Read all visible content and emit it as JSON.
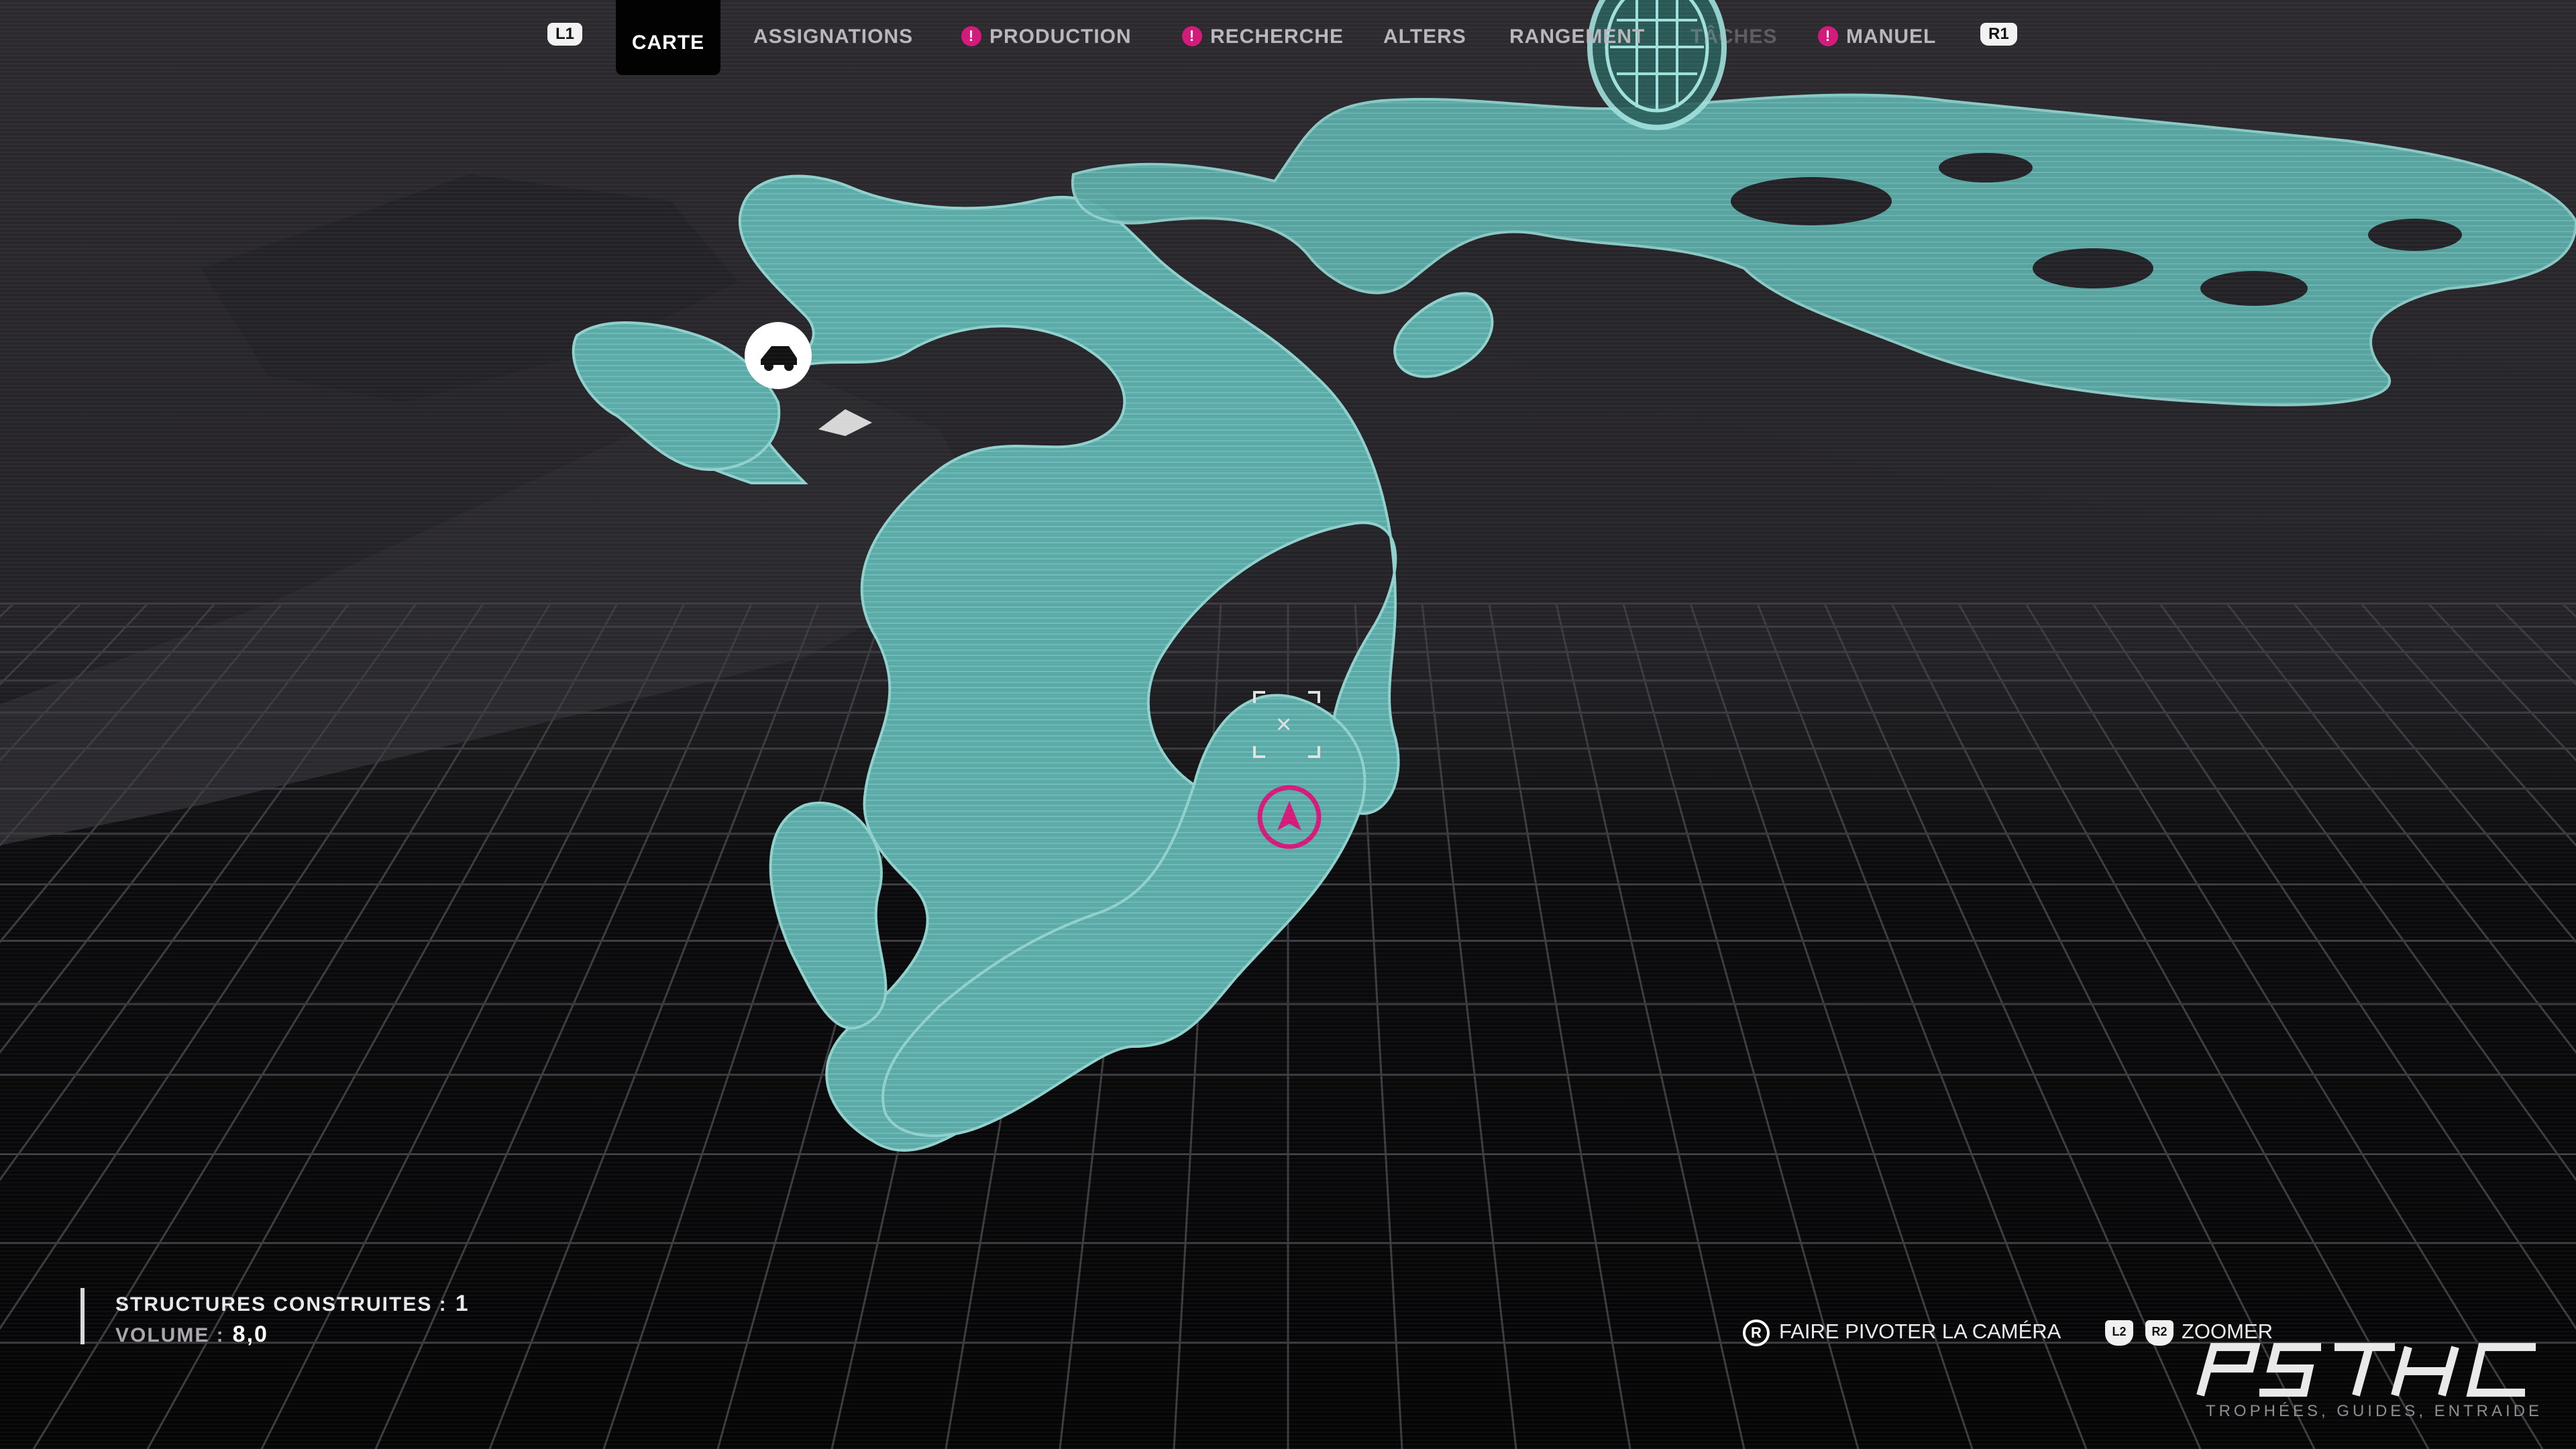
{
  "nav": {
    "left_shoulder": "L1",
    "right_shoulder": "R1",
    "tabs": [
      {
        "label": "CARTE",
        "active": true,
        "alert": false
      },
      {
        "label": "ASSIGNATIONS",
        "active": false,
        "alert": false
      },
      {
        "label": "PRODUCTION",
        "active": false,
        "alert": true
      },
      {
        "label": "RECHERCHE",
        "active": false,
        "alert": true
      },
      {
        "label": "ALTERS",
        "active": false,
        "alert": false
      },
      {
        "label": "RANGEMENT",
        "active": false,
        "alert": false
      },
      {
        "label": "TÂCHES",
        "active": false,
        "alert": false
      },
      {
        "label": "MANUEL",
        "active": false,
        "alert": true
      }
    ],
    "alert_glyph": "!"
  },
  "stats": {
    "structures_label": "STRUCTURES CONSTRUITES :",
    "structures_value": "1",
    "volume_label": "VOLUME :",
    "volume_value": "8,0"
  },
  "controls": {
    "rotate_button": "R",
    "rotate_label": "FAIRE PIVOTER LA CAMÉRA",
    "zoom_out_button": "L2",
    "zoom_in_button": "R2",
    "zoom_label": "ZOOMER"
  },
  "watermark": {
    "logo_text": "PSTHC",
    "tagline": "TROPHÉES, GUIDES, ENTRAIDE"
  },
  "map": {
    "cursor_glyph": "×",
    "map_icons": [
      "rover-vehicle-icon",
      "player-location-icon",
      "orb-structure-icon"
    ]
  },
  "colors": {
    "terrain_teal": "#5aa9a6",
    "alert_magenta": "#d41a7a",
    "background": "#0b0b0d"
  }
}
